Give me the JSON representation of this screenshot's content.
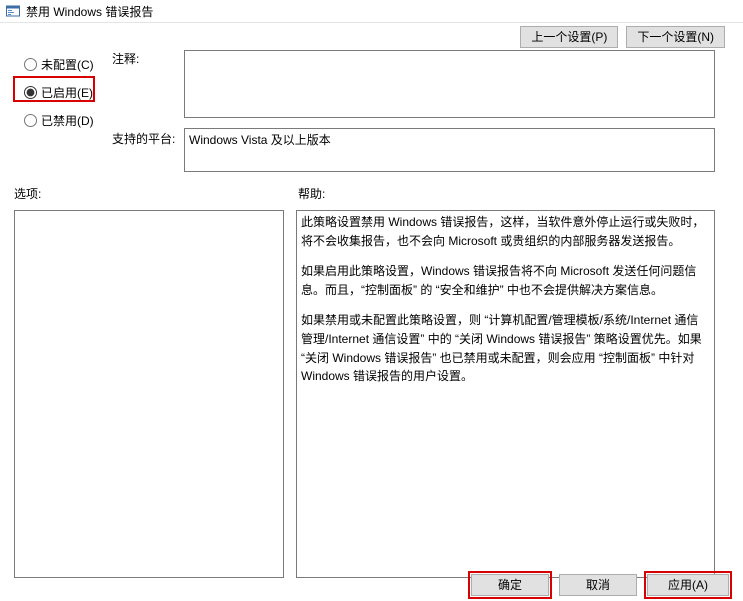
{
  "title": "禁用 Windows 错误报告",
  "nav": {
    "prev": "上一个设置(P)",
    "next": "下一个设置(N)"
  },
  "radios": {
    "not_configured": "未配置(C)",
    "enabled": "已启用(E)",
    "disabled": "已禁用(D)",
    "selected": "enabled"
  },
  "labels": {
    "comment": "注释:",
    "platform": "支持的平台:",
    "options": "选项:",
    "help": "帮助:"
  },
  "comment_value": "",
  "platform_value": "Windows Vista 及以上版本",
  "help_paragraphs": [
    "此策略设置禁用 Windows 错误报告，这样，当软件意外停止运行或失败时，将不会收集报告，也不会向 Microsoft 或贵组织的内部服务器发送报告。",
    "如果启用此策略设置，Windows 错误报告将不向 Microsoft 发送任何问题信息。而且，“控制面板” 的 “安全和维护” 中也不会提供解决方案信息。",
    "如果禁用或未配置此策略设置，则 “计算机配置/管理模板/系统/Internet 通信管理/Internet 通信设置” 中的 “关闭 Windows 错误报告” 策略设置优先。如果 “关闭 Windows 错误报告” 也已禁用或未配置，则会应用 “控制面板” 中针对 Windows 错误报告的用户设置。"
  ],
  "buttons": {
    "ok": "确定",
    "cancel": "取消",
    "apply": "应用(A)"
  }
}
